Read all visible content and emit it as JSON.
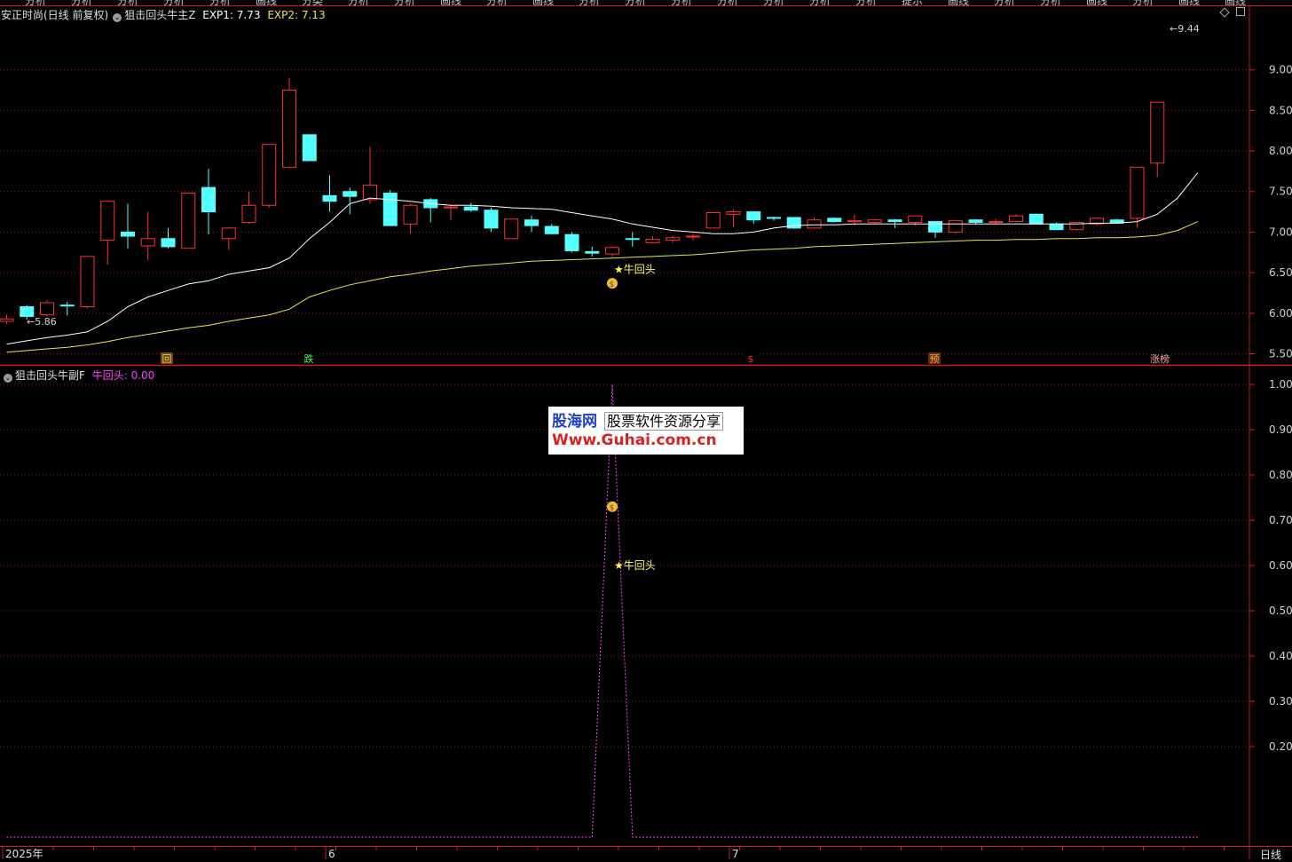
{
  "top_menu": [
    "分析",
    "分析",
    "分析",
    "分析",
    "分析",
    "画线",
    "分类",
    "分析",
    "分析",
    "画线",
    "分析",
    "画线",
    "分析",
    "分析",
    "分析",
    "分析",
    "分析",
    "分析",
    "分析",
    "提示",
    "画线",
    "分析",
    "分析",
    "画线",
    "分析",
    "画线",
    "画线"
  ],
  "header": {
    "stock": "安正时尚(日线 前复权)",
    "indicator": "狙击回头牛主Z",
    "exp1": "EXP1: 7.73",
    "exp2": "EXP2: 7.13"
  },
  "sub_header": {
    "indicator": "狙击回头牛副F",
    "value": "牛回头: 0.00"
  },
  "colors": {
    "up": "#ff3030",
    "down": "#54ffff",
    "exp1": "#ffffff",
    "exp2": "#e8e84a",
    "sub_line": "#ff40ff",
    "grid": "#a01010",
    "axis": "#d01818"
  },
  "price_axis": [
    "9.00",
    "8.50",
    "8.00",
    "7.50",
    "7.00",
    "6.50",
    "6.00",
    "5.50"
  ],
  "sub_axis": [
    "1.00",
    "0.90",
    "0.80",
    "0.70",
    "0.60",
    "0.50",
    "0.40",
    "0.30",
    "0.20"
  ],
  "labels": {
    "high": "9.44",
    "low": "5.86",
    "signal": "牛回头",
    "signal_sub": "牛回头",
    "money_icon": "money-bag-icon"
  },
  "markers": [
    "回",
    "跌",
    "$",
    "预",
    "涨榜"
  ],
  "time_axis": [
    "2025年",
    "6",
    "7"
  ],
  "period": "日线",
  "watermark": {
    "brand": "股海网",
    "slogan": "股票软件资源分享",
    "url": "Www.Guhai.com.cn"
  },
  "chart_data": {
    "type": "candlestick",
    "candles": [
      {
        "o": 5.9,
        "h": 5.98,
        "l": 5.87,
        "c": 5.93
      },
      {
        "o": 6.08,
        "h": 6.1,
        "l": 5.92,
        "c": 5.96
      },
      {
        "o": 5.98,
        "h": 6.16,
        "l": 5.96,
        "c": 6.13
      },
      {
        "o": 6.1,
        "h": 6.14,
        "l": 5.97,
        "c": 6.09
      },
      {
        "o": 6.08,
        "h": 6.7,
        "l": 6.06,
        "c": 6.7
      },
      {
        "o": 6.9,
        "h": 7.38,
        "l": 6.6,
        "c": 7.38
      },
      {
        "o": 7.0,
        "h": 7.35,
        "l": 6.8,
        "c": 6.95
      },
      {
        "o": 6.83,
        "h": 7.25,
        "l": 6.65,
        "c": 6.92
      },
      {
        "o": 6.92,
        "h": 7.05,
        "l": 6.8,
        "c": 6.82
      },
      {
        "o": 6.8,
        "h": 7.48,
        "l": 6.8,
        "c": 7.48
      },
      {
        "o": 7.55,
        "h": 7.78,
        "l": 6.97,
        "c": 7.25
      },
      {
        "o": 6.92,
        "h": 7.06,
        "l": 6.78,
        "c": 7.05
      },
      {
        "o": 7.12,
        "h": 7.5,
        "l": 7.1,
        "c": 7.33
      },
      {
        "o": 7.33,
        "h": 8.08,
        "l": 7.3,
        "c": 8.08
      },
      {
        "o": 7.8,
        "h": 8.9,
        "l": 7.8,
        "c": 8.75
      },
      {
        "o": 8.2,
        "h": 8.2,
        "l": 7.88,
        "c": 7.88
      },
      {
        "o": 7.45,
        "h": 7.7,
        "l": 7.25,
        "c": 7.38
      },
      {
        "o": 7.5,
        "h": 7.55,
        "l": 7.22,
        "c": 7.44
      },
      {
        "o": 7.4,
        "h": 8.05,
        "l": 7.35,
        "c": 7.58
      },
      {
        "o": 7.48,
        "h": 7.52,
        "l": 7.08,
        "c": 7.08
      },
      {
        "o": 7.1,
        "h": 7.35,
        "l": 6.98,
        "c": 7.33
      },
      {
        "o": 7.4,
        "h": 7.42,
        "l": 7.12,
        "c": 7.3
      },
      {
        "o": 7.31,
        "h": 7.33,
        "l": 7.15,
        "c": 7.31
      },
      {
        "o": 7.31,
        "h": 7.36,
        "l": 7.25,
        "c": 7.27
      },
      {
        "o": 7.27,
        "h": 7.3,
        "l": 7.0,
        "c": 7.05
      },
      {
        "o": 6.92,
        "h": 7.16,
        "l": 6.92,
        "c": 7.16
      },
      {
        "o": 7.15,
        "h": 7.2,
        "l": 7.0,
        "c": 7.08
      },
      {
        "o": 7.07,
        "h": 7.1,
        "l": 6.97,
        "c": 6.98
      },
      {
        "o": 6.97,
        "h": 7.0,
        "l": 6.75,
        "c": 6.77
      },
      {
        "o": 6.76,
        "h": 6.82,
        "l": 6.7,
        "c": 6.74
      },
      {
        "o": 6.73,
        "h": 6.82,
        "l": 6.7,
        "c": 6.81
      },
      {
        "o": 6.92,
        "h": 7.0,
        "l": 6.82,
        "c": 6.91
      },
      {
        "o": 6.87,
        "h": 6.95,
        "l": 6.86,
        "c": 6.91
      },
      {
        "o": 6.9,
        "h": 6.95,
        "l": 6.87,
        "c": 6.93
      },
      {
        "o": 6.94,
        "h": 6.98,
        "l": 6.9,
        "c": 6.95
      },
      {
        "o": 7.05,
        "h": 7.24,
        "l": 7.05,
        "c": 7.24
      },
      {
        "o": 7.22,
        "h": 7.28,
        "l": 7.06,
        "c": 7.25
      },
      {
        "o": 7.25,
        "h": 7.25,
        "l": 7.1,
        "c": 7.15
      },
      {
        "o": 7.18,
        "h": 7.19,
        "l": 7.14,
        "c": 7.17
      },
      {
        "o": 7.18,
        "h": 7.18,
        "l": 7.04,
        "c": 7.05
      },
      {
        "o": 7.05,
        "h": 7.18,
        "l": 7.04,
        "c": 7.15
      },
      {
        "o": 7.17,
        "h": 7.18,
        "l": 7.12,
        "c": 7.13
      },
      {
        "o": 7.13,
        "h": 7.22,
        "l": 7.08,
        "c": 7.14
      },
      {
        "o": 7.12,
        "h": 7.16,
        "l": 7.1,
        "c": 7.15
      },
      {
        "o": 7.15,
        "h": 7.16,
        "l": 7.05,
        "c": 7.13
      },
      {
        "o": 7.12,
        "h": 7.2,
        "l": 7.08,
        "c": 7.2
      },
      {
        "o": 7.13,
        "h": 7.13,
        "l": 6.93,
        "c": 7.0
      },
      {
        "o": 7.0,
        "h": 7.15,
        "l": 6.98,
        "c": 7.14
      },
      {
        "o": 7.15,
        "h": 7.16,
        "l": 7.1,
        "c": 7.12
      },
      {
        "o": 7.12,
        "h": 7.16,
        "l": 7.1,
        "c": 7.13
      },
      {
        "o": 7.13,
        "h": 7.22,
        "l": 7.12,
        "c": 7.2
      },
      {
        "o": 7.22,
        "h": 7.23,
        "l": 7.1,
        "c": 7.1
      },
      {
        "o": 7.1,
        "h": 7.12,
        "l": 7.03,
        "c": 7.03
      },
      {
        "o": 7.03,
        "h": 7.12,
        "l": 7.02,
        "c": 7.12
      },
      {
        "o": 7.1,
        "h": 7.18,
        "l": 7.08,
        "c": 7.17
      },
      {
        "o": 7.15,
        "h": 7.16,
        "l": 7.11,
        "c": 7.11
      },
      {
        "o": 7.17,
        "h": 7.8,
        "l": 7.05,
        "c": 7.8
      },
      {
        "o": 7.85,
        "h": 8.6,
        "l": 7.68,
        "c": 8.6
      }
    ],
    "exp1": [
      5.62,
      5.66,
      5.7,
      5.73,
      5.77,
      5.9,
      6.08,
      6.2,
      6.28,
      6.36,
      6.4,
      6.48,
      6.52,
      6.56,
      6.68,
      6.92,
      7.12,
      7.35,
      7.42,
      7.4,
      7.38,
      7.35,
      7.33,
      7.33,
      7.32,
      7.3,
      7.29,
      7.28,
      7.24,
      7.2,
      7.16,
      7.1,
      7.06,
      7.02,
      7.0,
      6.98,
      6.98,
      7.0,
      7.05,
      7.08,
      7.09,
      7.09,
      7.1,
      7.1,
      7.1,
      7.1,
      7.1,
      7.1,
      7.1,
      7.1,
      7.1,
      7.1,
      7.1,
      7.1,
      7.11,
      7.11,
      7.13,
      7.22,
      7.42,
      7.73
    ],
    "exp2": [
      5.52,
      5.54,
      5.56,
      5.58,
      5.61,
      5.65,
      5.7,
      5.74,
      5.78,
      5.82,
      5.85,
      5.9,
      5.94,
      5.98,
      6.05,
      6.2,
      6.28,
      6.35,
      6.4,
      6.45,
      6.48,
      6.52,
      6.55,
      6.58,
      6.6,
      6.62,
      6.64,
      6.65,
      6.66,
      6.67,
      6.68,
      6.69,
      6.7,
      6.71,
      6.72,
      6.74,
      6.76,
      6.78,
      6.79,
      6.8,
      6.82,
      6.83,
      6.84,
      6.85,
      6.86,
      6.87,
      6.88,
      6.89,
      6.9,
      6.9,
      6.91,
      6.91,
      6.92,
      6.92,
      6.93,
      6.93,
      6.94,
      6.96,
      7.02,
      7.13
    ],
    "signal_index": 30,
    "sub_series": {
      "name": "牛回头",
      "values": [
        0,
        0,
        0,
        0,
        0,
        0,
        0,
        0,
        0,
        0,
        0,
        0,
        0,
        0,
        0,
        0,
        0,
        0,
        0,
        0,
        0,
        0,
        0,
        0,
        0,
        0,
        0,
        0,
        0,
        0,
        1,
        0,
        0,
        0,
        0,
        0,
        0,
        0,
        0,
        0,
        0,
        0,
        0,
        0,
        0,
        0,
        0,
        0,
        0,
        0,
        0,
        0,
        0,
        0,
        0,
        0,
        0,
        0,
        0,
        0
      ]
    },
    "price_range": [
      5.44,
      9.62
    ],
    "sub_range": [
      0,
      1.0
    ]
  }
}
